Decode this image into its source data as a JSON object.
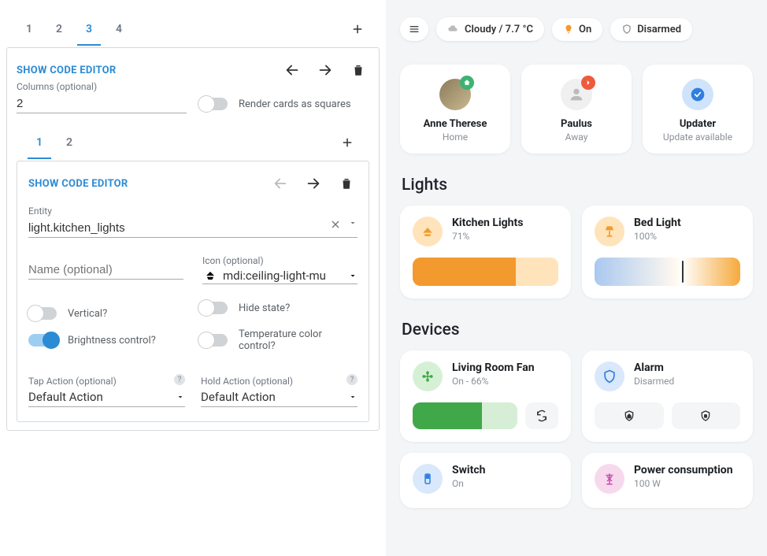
{
  "editor": {
    "outer_tabs": [
      "1",
      "2",
      "3",
      "4"
    ],
    "outer_active_index": 2,
    "show_code_label": "SHOW CODE EDITOR",
    "columns_label": "Columns (optional)",
    "columns_value": "2",
    "render_squares_label": "Render cards as squares",
    "render_squares_on": false,
    "inner_tabs": [
      "1",
      "2"
    ],
    "inner_active_index": 0,
    "entity_label": "Entity",
    "entity_value": "light.kitchen_lights",
    "name_label": "Name (optional)",
    "name_value": "",
    "icon_label": "Icon (optional)",
    "icon_value": "mdi:ceiling-light-mu",
    "toggles": {
      "vertical": {
        "label": "Vertical?",
        "on": false
      },
      "hide_state": {
        "label": "Hide state?",
        "on": false
      },
      "brightness": {
        "label": "Brightness control?",
        "on": true
      },
      "temp_color": {
        "label": "Temperature color control?",
        "on": false
      }
    },
    "tap_action_label": "Tap Action (optional)",
    "tap_action_value": "Default Action",
    "hold_action_label": "Hold Action (optional)",
    "hold_action_value": "Default Action"
  },
  "dashboard": {
    "weather_chip": "Cloudy / 7.7 °C",
    "state_chip": "On",
    "alarm_chip": "Disarmed",
    "entities": [
      {
        "name": "Anne Therese",
        "sub": "Home",
        "badge_color": "#3cb371",
        "badge_icon": "home"
      },
      {
        "name": "Paulus",
        "sub": "Away",
        "badge_color": "#f05a3c",
        "badge_icon": "away"
      },
      {
        "name": "Updater",
        "sub": "Update available",
        "icon_bg": "#cfe4fb",
        "icon_color": "#2f7fe0",
        "icon": "check"
      }
    ],
    "lights_title": "Lights",
    "lights": [
      {
        "name": "Kitchen Lights",
        "sub": "71%",
        "icon_bg": "#ffe3bb",
        "icon_fg": "#f29a2e",
        "fill_pct": 71,
        "slider_bg": "#ffe3bb",
        "slider_fill": "#f29a2e"
      },
      {
        "name": "Bed Light",
        "sub": "100%",
        "icon_bg": "#ffe3bb",
        "icon_fg": "#f29a2e",
        "fill_pct": 100,
        "gradient": true
      }
    ],
    "devices_title": "Devices",
    "devices": {
      "fan": {
        "name": "Living Room Fan",
        "sub": "On - 66%",
        "icon_bg": "#d6f0d6",
        "icon_fg": "#41a84a",
        "fill_pct": 66
      },
      "alarm": {
        "name": "Alarm",
        "sub": "Disarmed",
        "icon_bg": "#d9e8fb",
        "icon_fg": "#2f7fe0"
      },
      "switch": {
        "name": "Switch",
        "sub": "On",
        "icon_bg": "#d9e8fb",
        "icon_fg": "#2f7fe0"
      },
      "power": {
        "name": "Power consumption",
        "sub": "100 W",
        "icon_bg": "#f7d9ee",
        "icon_fg": "#c84da8"
      }
    }
  }
}
